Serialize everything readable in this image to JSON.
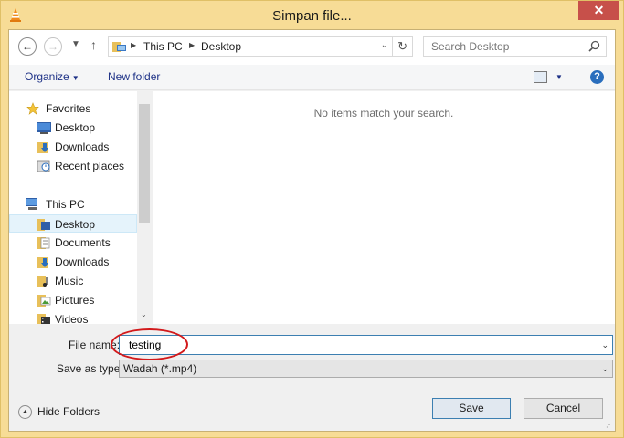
{
  "window": {
    "title": "Simpan file...",
    "close_glyph": "✕"
  },
  "nav": {
    "back_glyph": "←",
    "forward_glyph": "→",
    "recent_glyph": "▼",
    "up_glyph": "↑"
  },
  "address": {
    "crumbs": [
      "This PC",
      "Desktop"
    ],
    "separator": "▶",
    "dropdown_glyph": "⌄",
    "refresh_glyph": "↻"
  },
  "search": {
    "placeholder": "Search Desktop"
  },
  "toolbar": {
    "organize_label": "Organize",
    "organize_arrow": "▼",
    "new_folder_label": "New folder",
    "view_arrow": "▼",
    "help_glyph": "?"
  },
  "sidebar": {
    "favorites": {
      "label": "Favorites",
      "items": [
        {
          "label": "Desktop",
          "icon": "desktop-icon"
        },
        {
          "label": "Downloads",
          "icon": "downloads-icon"
        },
        {
          "label": "Recent places",
          "icon": "recent-places-icon"
        }
      ]
    },
    "this_pc": {
      "label": "This PC",
      "items": [
        {
          "label": "Desktop",
          "icon": "desktop-folder-icon",
          "selected": true
        },
        {
          "label": "Documents",
          "icon": "documents-icon"
        },
        {
          "label": "Downloads",
          "icon": "downloads-icon"
        },
        {
          "label": "Music",
          "icon": "music-icon"
        },
        {
          "label": "Pictures",
          "icon": "pictures-icon"
        },
        {
          "label": "Videos",
          "icon": "videos-icon"
        }
      ]
    },
    "scroll_down_glyph": "⌄"
  },
  "content": {
    "empty_message": "No items match your search."
  },
  "form": {
    "file_name_label": "File name:",
    "file_name_value": "testing",
    "save_as_type_label": "Save as type:",
    "save_as_type_value": "Wadah (*.mp4)",
    "dropdown_glyph": "⌄"
  },
  "footer": {
    "hide_folders_label": "Hide Folders",
    "hide_folders_glyph": "▲",
    "save_label": "Save",
    "cancel_label": "Cancel",
    "grip_glyph": "⋰"
  },
  "colors": {
    "title_bar": "#f7dc96",
    "close_button": "#c7504a",
    "link_text": "#1e3287",
    "highlight_ellipse": "#d2191b",
    "selection": "#e5f3fb"
  }
}
